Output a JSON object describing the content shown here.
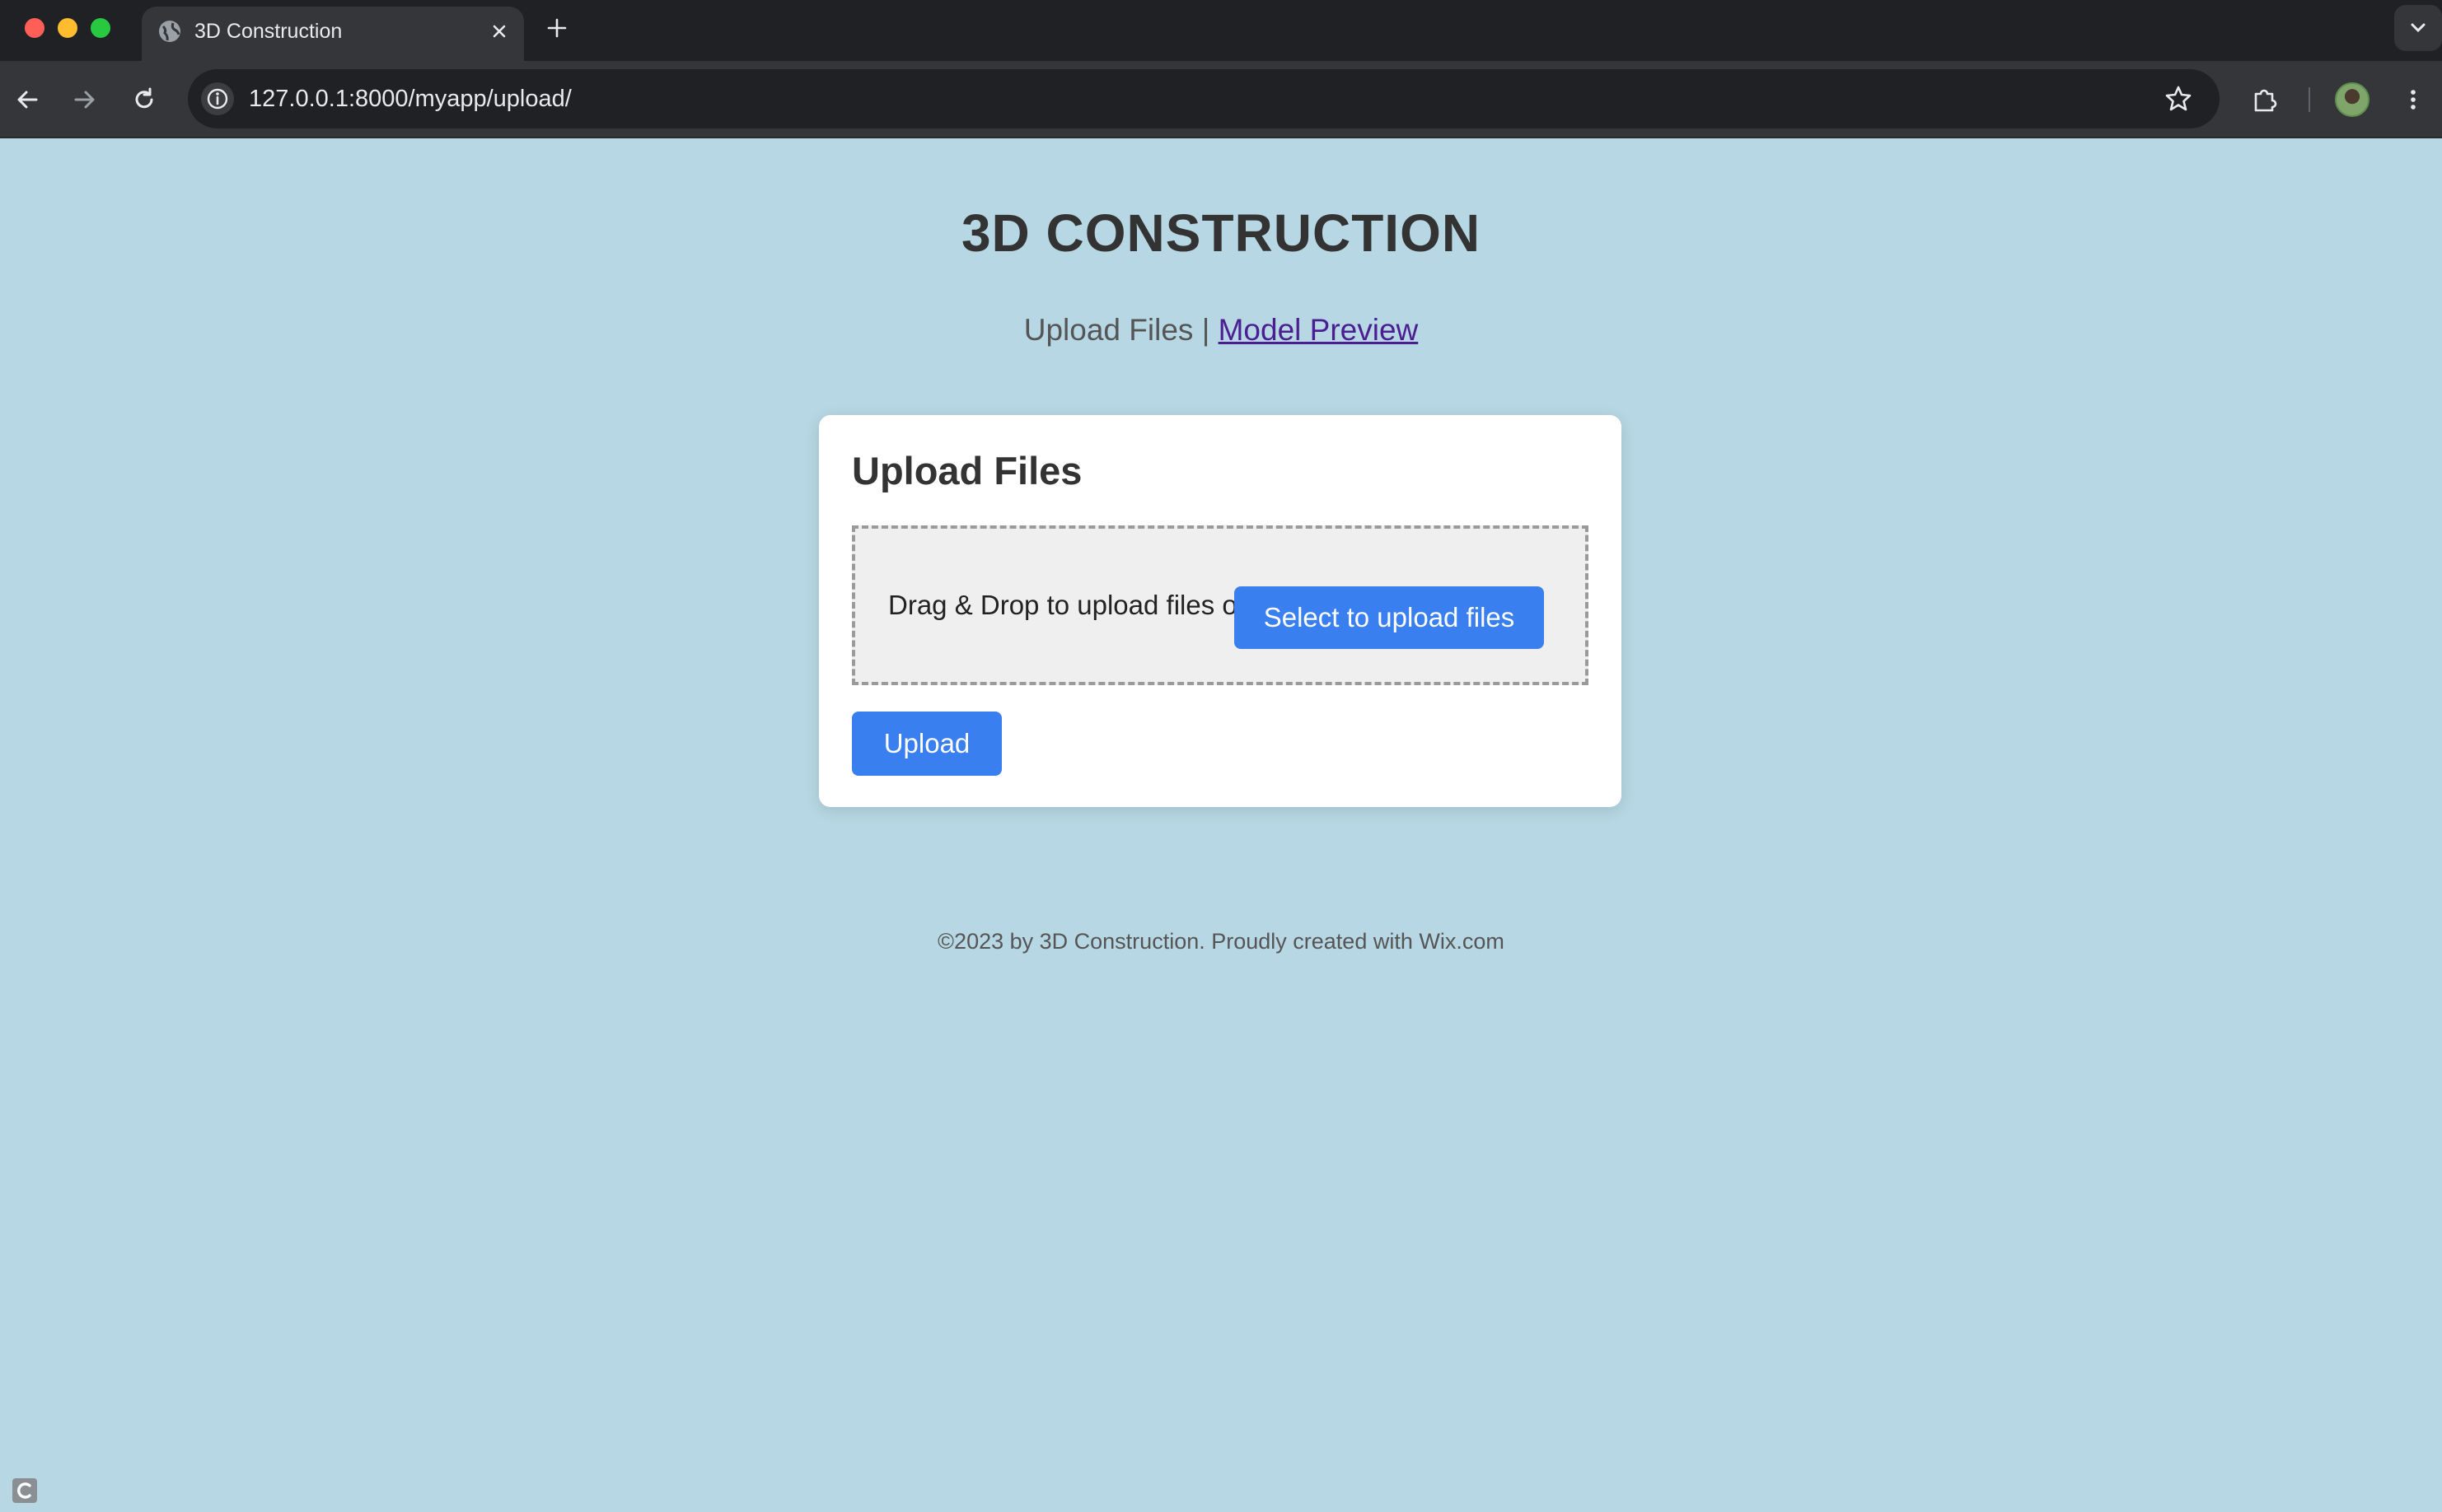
{
  "browser": {
    "tab_title": "3D Construction",
    "url": "127.0.0.1:8000/myapp/upload/",
    "icons": [
      "globe-icon",
      "close-icon",
      "plus-icon",
      "chevron-down-icon",
      "back-arrow-icon",
      "forward-arrow-icon",
      "reload-icon",
      "info-icon",
      "star-icon",
      "extensions-icon",
      "avatar",
      "more-vert-icon"
    ]
  },
  "site": {
    "title": "3D CONSTRUCTION",
    "nav": {
      "current": "Upload Files",
      "separator": "|",
      "link": "Model Preview"
    }
  },
  "upload_card": {
    "title": "Upload Files",
    "dropzone_text": "Drag & Drop to upload files or",
    "select_button": "Select to upload files",
    "upload_button": "Upload"
  },
  "footer": {
    "text": "©2023 by 3D Construction. Proudly created with Wix.com"
  },
  "colors": {
    "page_background": "#b6d7e3",
    "button_blue": "#3a7ff0",
    "link_purple": "#4b1e92"
  }
}
